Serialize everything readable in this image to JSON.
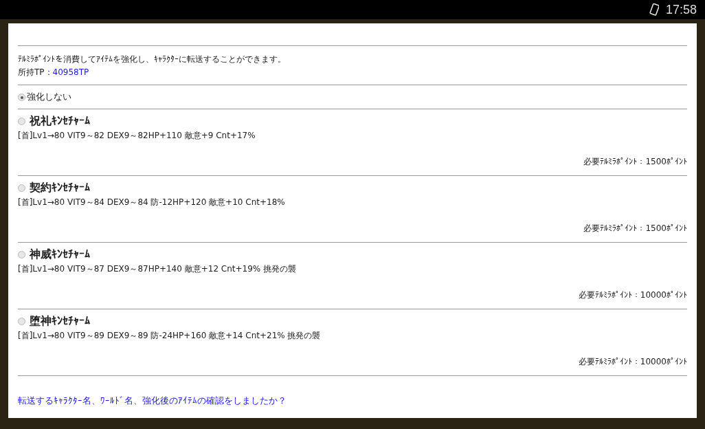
{
  "status_bar": {
    "time": "17:58"
  },
  "intro": {
    "text": "ﾃﾙﾐﾗﾎﾟｲﾝﾄを消費してｱｲﾃﾑを強化し、ｷｬﾗｸﾀｰに転送することができます。",
    "tp_label": "所持TP：",
    "tp_value": "40958TP"
  },
  "options": [
    {
      "kind": "plain",
      "label": "強化しない",
      "selected": true
    },
    {
      "kind": "item",
      "label": "祝礼ｷﾝｾﾁｬｰﾑ",
      "selected": false,
      "stats": "[首]Lv1→80 VIT9～82 DEX9～82HP+110 敵意+9 Cnt+17%",
      "cost": "必要ﾃﾙﾐﾗﾎﾟｲﾝﾄ：1500ﾎﾟｲﾝﾄ"
    },
    {
      "kind": "item",
      "label": "契約ｷﾝｾﾁｬｰﾑ",
      "selected": false,
      "stats": "[首]Lv1→80 VIT9～84 DEX9～84 防-12HP+120 敵意+10 Cnt+18%",
      "cost": "必要ﾃﾙﾐﾗﾎﾟｲﾝﾄ：1500ﾎﾟｲﾝﾄ"
    },
    {
      "kind": "item",
      "label": "神威ｷﾝｾﾁｬｰﾑ",
      "selected": false,
      "stats": "[首]Lv1→80 VIT9～87 DEX9～87HP+140 敵意+12 Cnt+19% 挑発の襲",
      "cost": "必要ﾃﾙﾐﾗﾎﾟｲﾝﾄ：10000ﾎﾟｲﾝﾄ"
    },
    {
      "kind": "item",
      "label": "堕神ｷﾝｾﾁｬｰﾑ",
      "selected": false,
      "stats": "[首]Lv1→80 VIT9～89 DEX9～89 防-24HP+160 敵意+14 Cnt+21% 挑発の襲",
      "cost": "必要ﾃﾙﾐﾗﾎﾟｲﾝﾄ：10000ﾎﾟｲﾝﾄ"
    }
  ],
  "confirm_link": "転送するｷｬﾗｸﾀｰ名、ﾜｰﾙﾄﾞ名、強化後のｱｲﾃﾑの確認をしましたか？"
}
